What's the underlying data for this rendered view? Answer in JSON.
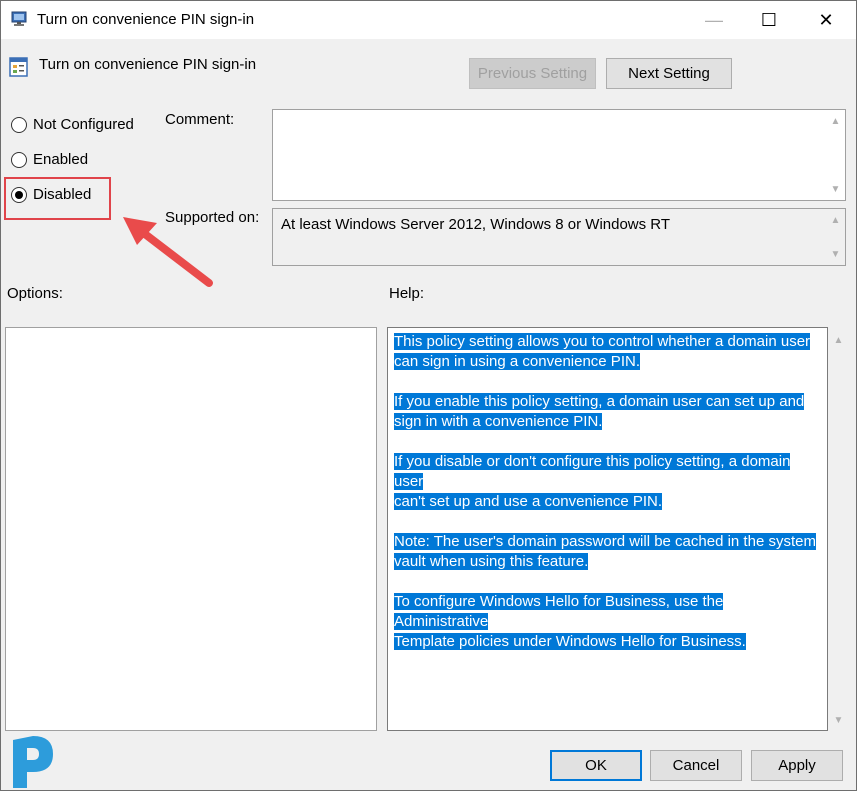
{
  "window": {
    "title": "Turn on convenience PIN sign-in",
    "controls": {
      "minimize": "—",
      "maximize": "☐",
      "close": "✕"
    }
  },
  "header": {
    "policy_title": "Turn on convenience PIN sign-in",
    "previous_label": "Previous Setting",
    "next_label": "Next Setting"
  },
  "state": {
    "options": [
      {
        "label": "Not Configured",
        "selected": false
      },
      {
        "label": "Enabled",
        "selected": false
      },
      {
        "label": "Disabled",
        "selected": true
      }
    ]
  },
  "comment": {
    "label": "Comment:",
    "value": ""
  },
  "supported": {
    "label": "Supported on:",
    "value": "At least Windows Server 2012, Windows 8 or Windows RT"
  },
  "options_panel": {
    "label": "Options:"
  },
  "help_panel": {
    "label": "Help:",
    "paragraphs": [
      [
        "This policy setting allows you to control whether a domain user",
        "can sign in using a convenience PIN."
      ],
      [
        "If you enable this policy setting, a domain user can set up and",
        "sign in with a convenience PIN."
      ],
      [
        "If you disable or don't configure this policy setting, a domain user",
        "can't set up and use a convenience PIN."
      ],
      [
        "Note: The user's domain password will be cached in the system",
        "vault when using this feature."
      ],
      [
        "To configure Windows Hello for Business, use the Administrative",
        "Template policies under Windows Hello for Business."
      ]
    ]
  },
  "footer": {
    "ok_label": "OK",
    "cancel_label": "Cancel",
    "apply_label": "Apply"
  },
  "colors": {
    "selection": "#0078d7",
    "highlight": "#e0444a",
    "logo": "#2d9cdb"
  },
  "icons": [
    "policy-app-icon",
    "policy-setting-icon",
    "annotation-arrow",
    "brand-logo"
  ]
}
